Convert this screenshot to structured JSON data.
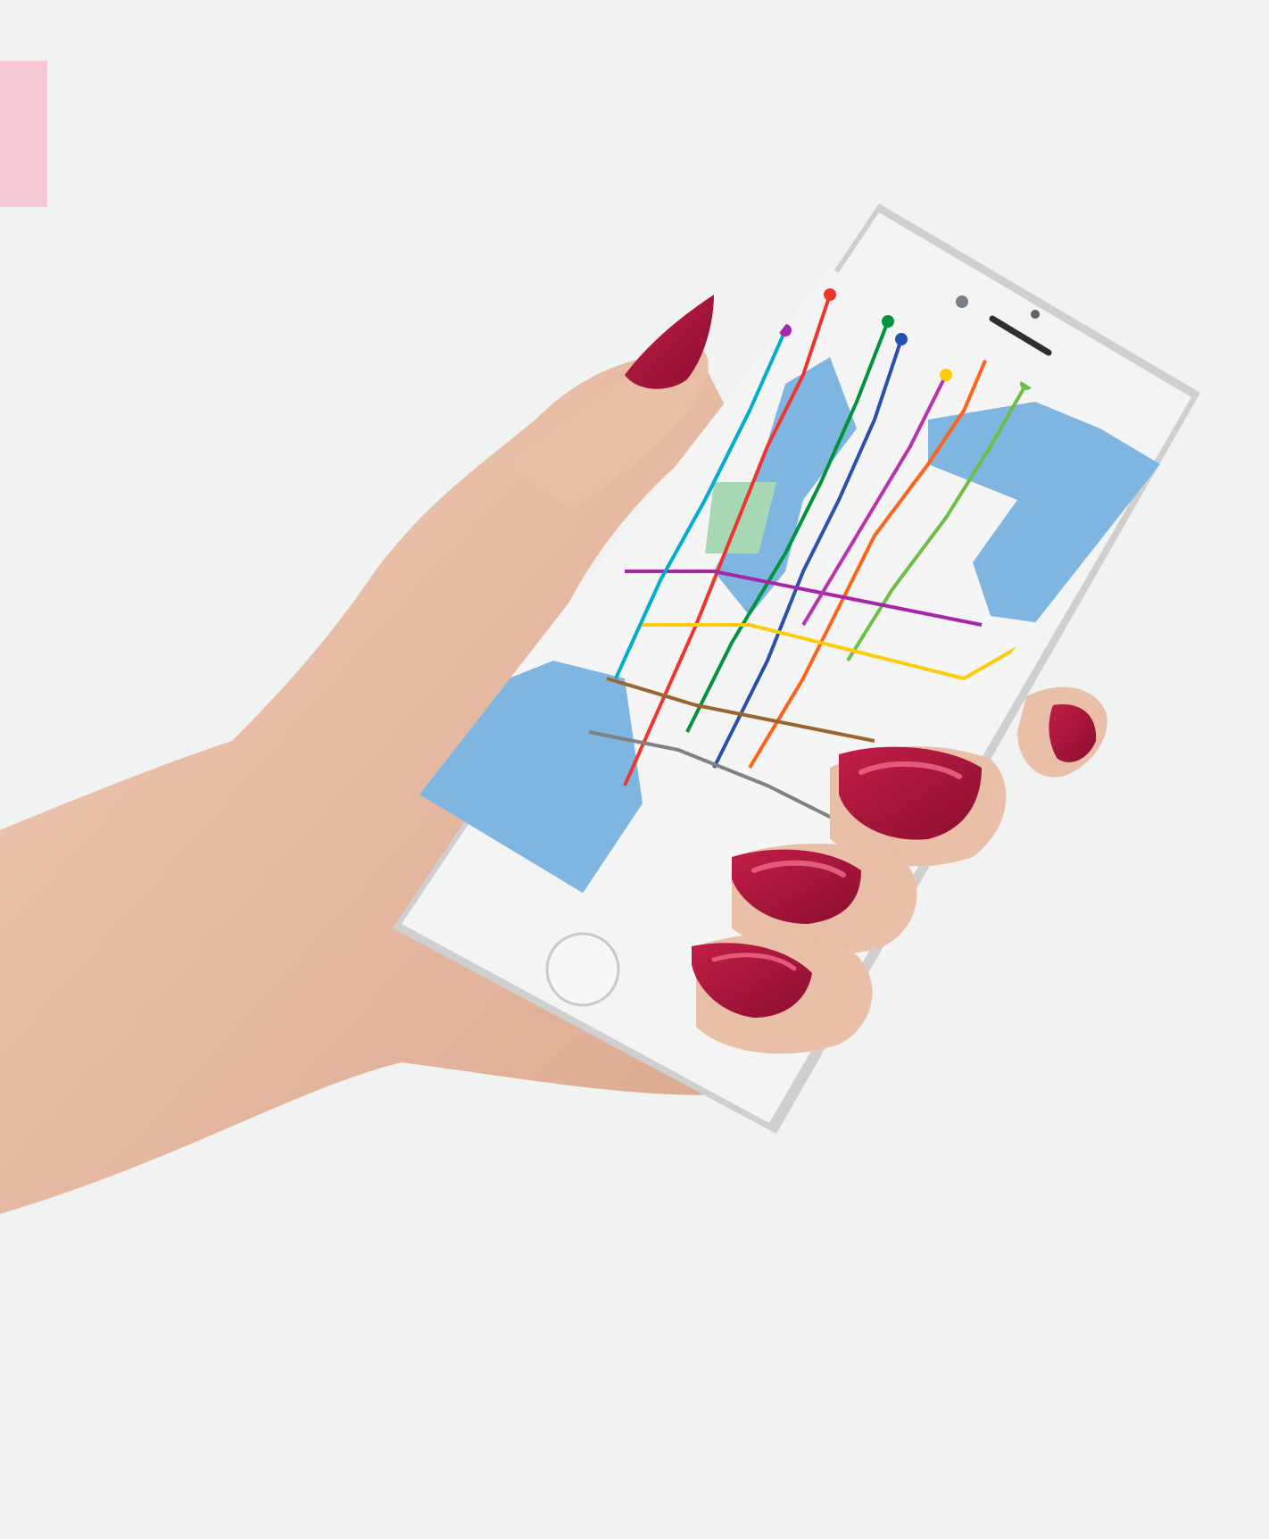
{
  "scene": {
    "description_icon": "hand-holding-phone",
    "colors": {
      "background": "#f1f2f2",
      "skin": "#e9bfa8",
      "skin_shadow": "#d29c82",
      "nail": "#a2143a",
      "nail_highlight": "#e45b7a",
      "phone_frame": "#f4f4f4",
      "phone_edge": "#cfcfcf",
      "water": "#7fb6e1",
      "land": "#f5f5f5",
      "park": "#a6d8b4",
      "accent_tab": "#f5c8d4"
    }
  },
  "map": {
    "lines": [
      {
        "color": "#ee352e"
      },
      {
        "color": "#00933c"
      },
      {
        "color": "#2850ad"
      },
      {
        "color": "#ff6319"
      },
      {
        "color": "#6cbe45"
      },
      {
        "color": "#a626aa"
      },
      {
        "color": "#fccc0a"
      },
      {
        "color": "#996633"
      },
      {
        "color": "#00add0"
      },
      {
        "color": "#b933ad"
      },
      {
        "color": "#808183"
      }
    ]
  }
}
